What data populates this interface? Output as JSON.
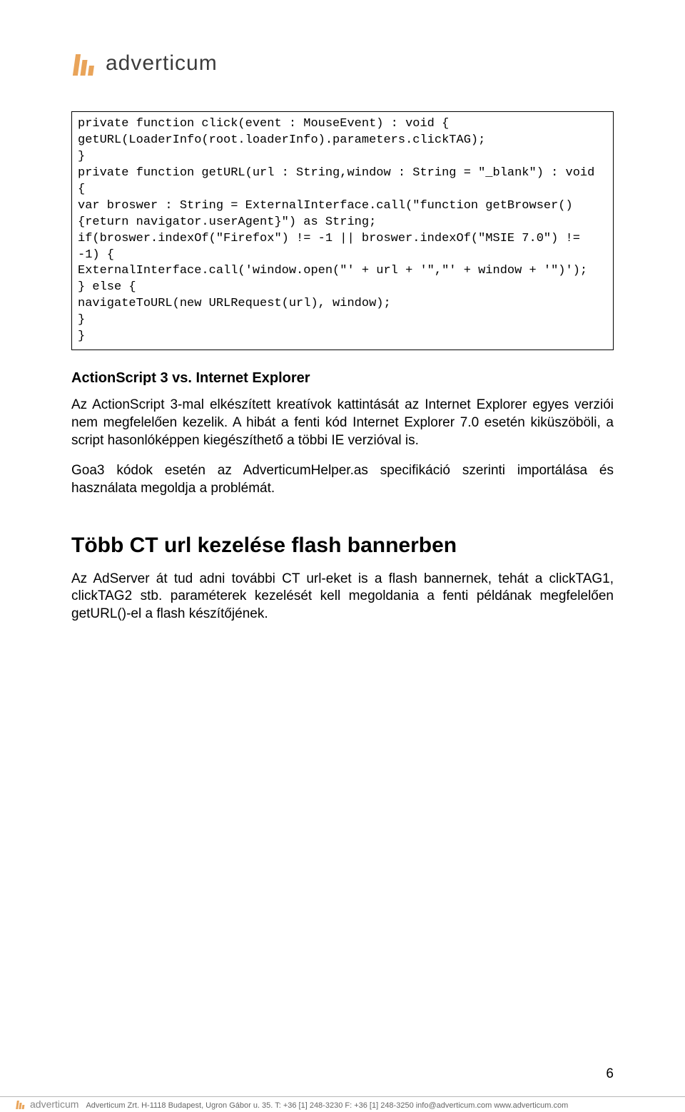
{
  "logo": {
    "text": "adverticum"
  },
  "code_block": "private function click(event : MouseEvent) : void {\ngetURL(LoaderInfo(root.loaderInfo).parameters.clickTAG);\n}\nprivate function getURL(url : String,window : String = \"_blank\") : void {\nvar broswer : String = ExternalInterface.call(\"function getBrowser(){return navigator.userAgent}\") as String;\nif(broswer.indexOf(\"Firefox\") != -1 || broswer.indexOf(\"MSIE 7.0\") != -1) {\nExternalInterface.call('window.open(\"' + url + '\",\"' + window + '\")');\n} else {\nnavigateToURL(new URLRequest(url), window);\n}\n}",
  "section1": {
    "heading": "ActionScript 3 vs. Internet Explorer",
    "p1": "Az ActionScript 3-mal elkészített kreatívok kattintását az Internet Explorer egyes verziói nem megfelelően kezelik. A hibát a fenti kód Internet Explorer 7.0 esetén kiküszöböli, a script hasonlóképpen kiegészíthető a többi IE verzióval is.",
    "p2": "Goa3 kódok esetén az AdverticumHelper.as specifikáció szerinti importálása és használata megoldja a problémát."
  },
  "section2": {
    "heading": "Több CT url kezelése flash bannerben",
    "p1": "Az AdServer át tud adni további CT url-eket is a flash bannernek, tehát a clickTAG1, clickTAG2 stb. paraméterek kezelését kell megoldania a fenti példának megfelelően getURL()-el a flash készítőjének."
  },
  "page_number": "6",
  "footer": {
    "brand": "adverticum",
    "text": "Adverticum Zrt. H-1118 Budapest, Ugron Gábor u. 35.  T: +36 [1] 248-3230 F: +36 [1] 248-3250  info@adverticum.com   www.adverticum.com"
  }
}
